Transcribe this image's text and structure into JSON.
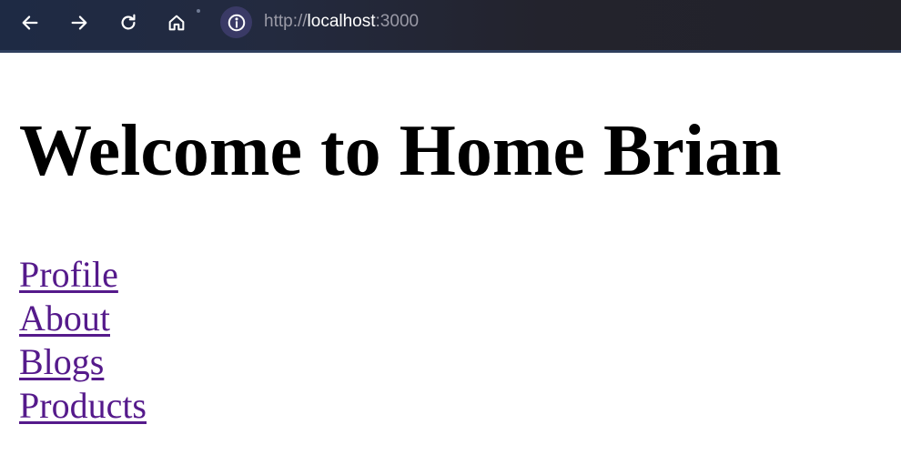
{
  "browser": {
    "url_scheme": "http://",
    "url_host": "localhost",
    "url_port": ":3000",
    "icons": {
      "back": "arrow-left-icon",
      "forward": "arrow-right-icon",
      "reload": "reload-icon",
      "home": "home-icon",
      "site_info": "info-icon"
    },
    "colors": {
      "toolbar": "#232a3f",
      "info_bg": "#3a3a66",
      "url_text": "#9a9aa6"
    }
  },
  "page": {
    "title": "Welcome to Home Brian",
    "links": [
      {
        "label": "Profile"
      },
      {
        "label": "About"
      },
      {
        "label": "Blogs"
      },
      {
        "label": "Products"
      }
    ],
    "colors": {
      "link_visited": "#551a8b",
      "text": "#000000"
    }
  }
}
